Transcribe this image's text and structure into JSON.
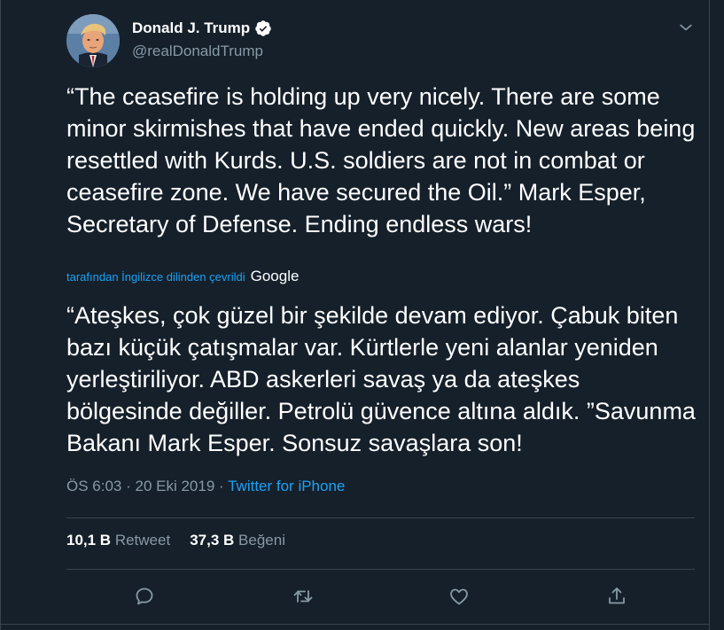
{
  "author": {
    "name": "Donald J. Trump",
    "handle": "@realDonaldTrump",
    "verified": true
  },
  "tweet": {
    "text": "“The ceasefire is holding up very nicely. There are some minor skirmishes that have ended quickly. New areas being resettled with Kurds. U.S. soldiers are not in combat or ceasefire zone. We have secured the Oil.” Mark Esper, Secretary of Defense. Ending endless wars!"
  },
  "translation": {
    "label": "tarafından İngilizce dilinden çevrildi",
    "provider": "Google",
    "text": "“Ateşkes, çok güzel bir şekilde devam ediyor. Çabuk biten bazı küçük çatışmalar var. Kürtlerle yeni alanlar yeniden yerleştiriliyor. ABD askerleri savaş ya da ateşkes bölgesinde değiller. Petrolü güvence altına aldık. ”Savunma Bakanı Mark Esper. Sonsuz savaşlara son!"
  },
  "meta": {
    "time": "ÖS 6:03",
    "separator1": " · ",
    "date": "20 Eki 2019",
    "separator2": " · ",
    "source": "Twitter for iPhone"
  },
  "stats": {
    "retweets_count": "10,1 B",
    "retweets_label": "Retweet",
    "likes_count": "37,3 B",
    "likes_label": "Beğeni"
  },
  "icons": {
    "reply": "reply-icon",
    "retweet": "retweet-icon",
    "like": "heart-icon",
    "share": "share-icon",
    "verified": "verified-badge-icon",
    "menu": "chevron-down-icon"
  },
  "colors": {
    "background": "#15202b",
    "text": "#ffffff",
    "secondary": "#8899a6",
    "accent": "#1da1f2",
    "border": "#38444d"
  }
}
